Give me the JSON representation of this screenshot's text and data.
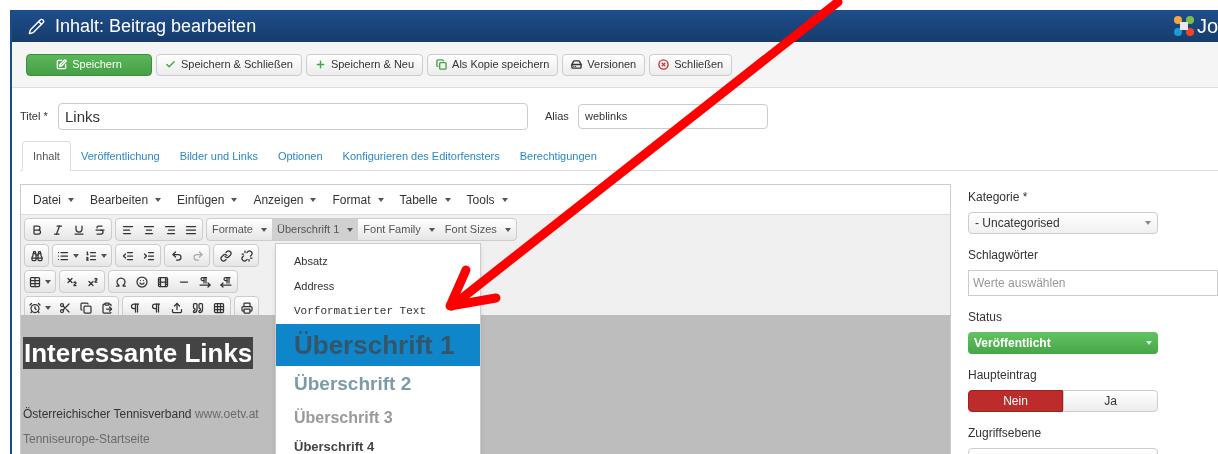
{
  "header": {
    "title": "Inhalt: Beitrag bearbeiten",
    "logo_text": "Jo"
  },
  "toolbar": [
    {
      "label": "Speichern",
      "kind": "save"
    },
    {
      "label": "Speichern & Schließen",
      "kind": "check"
    },
    {
      "label": "Speichern & Neu",
      "kind": "plus"
    },
    {
      "label": "Als Kopie speichern",
      "kind": "copy"
    },
    {
      "label": "Versionen",
      "kind": "versions"
    },
    {
      "label": "Schließen",
      "kind": "close"
    }
  ],
  "title_field": {
    "label": "Titel *",
    "value": "Links"
  },
  "alias_field": {
    "label": "Alias",
    "value": "weblinks"
  },
  "tabs": [
    {
      "label": "Inhalt",
      "selected": true
    },
    {
      "label": "Veröffentlichung",
      "selected": false
    },
    {
      "label": "Bilder und Links",
      "selected": false
    },
    {
      "label": "Optionen",
      "selected": false
    },
    {
      "label": "Konfigurieren des Editorfensters",
      "selected": false
    },
    {
      "label": "Berechtigungen",
      "selected": false
    }
  ],
  "editor": {
    "menus": [
      "Datei",
      "Bearbeiten",
      "Einfügen",
      "Anzeigen",
      "Format",
      "Tabelle",
      "Tools"
    ],
    "format_dropdowns": [
      {
        "label": "Formate",
        "pressed": false
      },
      {
        "label": "Überschrift 1",
        "pressed": true
      },
      {
        "label": "Font Family",
        "pressed": false
      },
      {
        "label": "Font Sizes",
        "pressed": false
      }
    ],
    "dropdown_items": [
      {
        "label": "Absatz",
        "kind": "paragraph",
        "selected": false
      },
      {
        "label": "Address",
        "kind": "address",
        "selected": false
      },
      {
        "label": "Vorformatierter Text",
        "kind": "pre",
        "selected": false
      },
      {
        "label": "Überschrift 1",
        "kind": "h1",
        "selected": true
      },
      {
        "label": "Überschrift 2",
        "kind": "h2",
        "selected": false
      },
      {
        "label": "Überschrift 3",
        "kind": "h3",
        "selected": false
      },
      {
        "label": "Überschrift 4",
        "kind": "h4",
        "selected": false
      }
    ],
    "content": {
      "heading": {
        "text": "Interessante Links",
        "selected": true
      },
      "paragraphs": [
        {
          "text": "Österreichischer Tennisverband",
          "link": "www.oetv.at"
        },
        {
          "link": "Tenniseurope-Startseite"
        }
      ]
    }
  },
  "sidebar": [
    {
      "label": "Kategorie *",
      "kind": "select",
      "value": "- Uncategorised"
    },
    {
      "label": "Schlagwörter",
      "kind": "tags",
      "placeholder": "Werte auswählen"
    },
    {
      "label": "Status",
      "kind": "status",
      "value": "Veröffentlicht"
    },
    {
      "label": "Haupteintrag",
      "kind": "toggle",
      "options": [
        {
          "label": "Nein",
          "selected": true
        },
        {
          "label": "Ja",
          "selected": false
        }
      ]
    },
    {
      "label": "Zugriffsebene",
      "kind": "select"
    }
  ]
}
